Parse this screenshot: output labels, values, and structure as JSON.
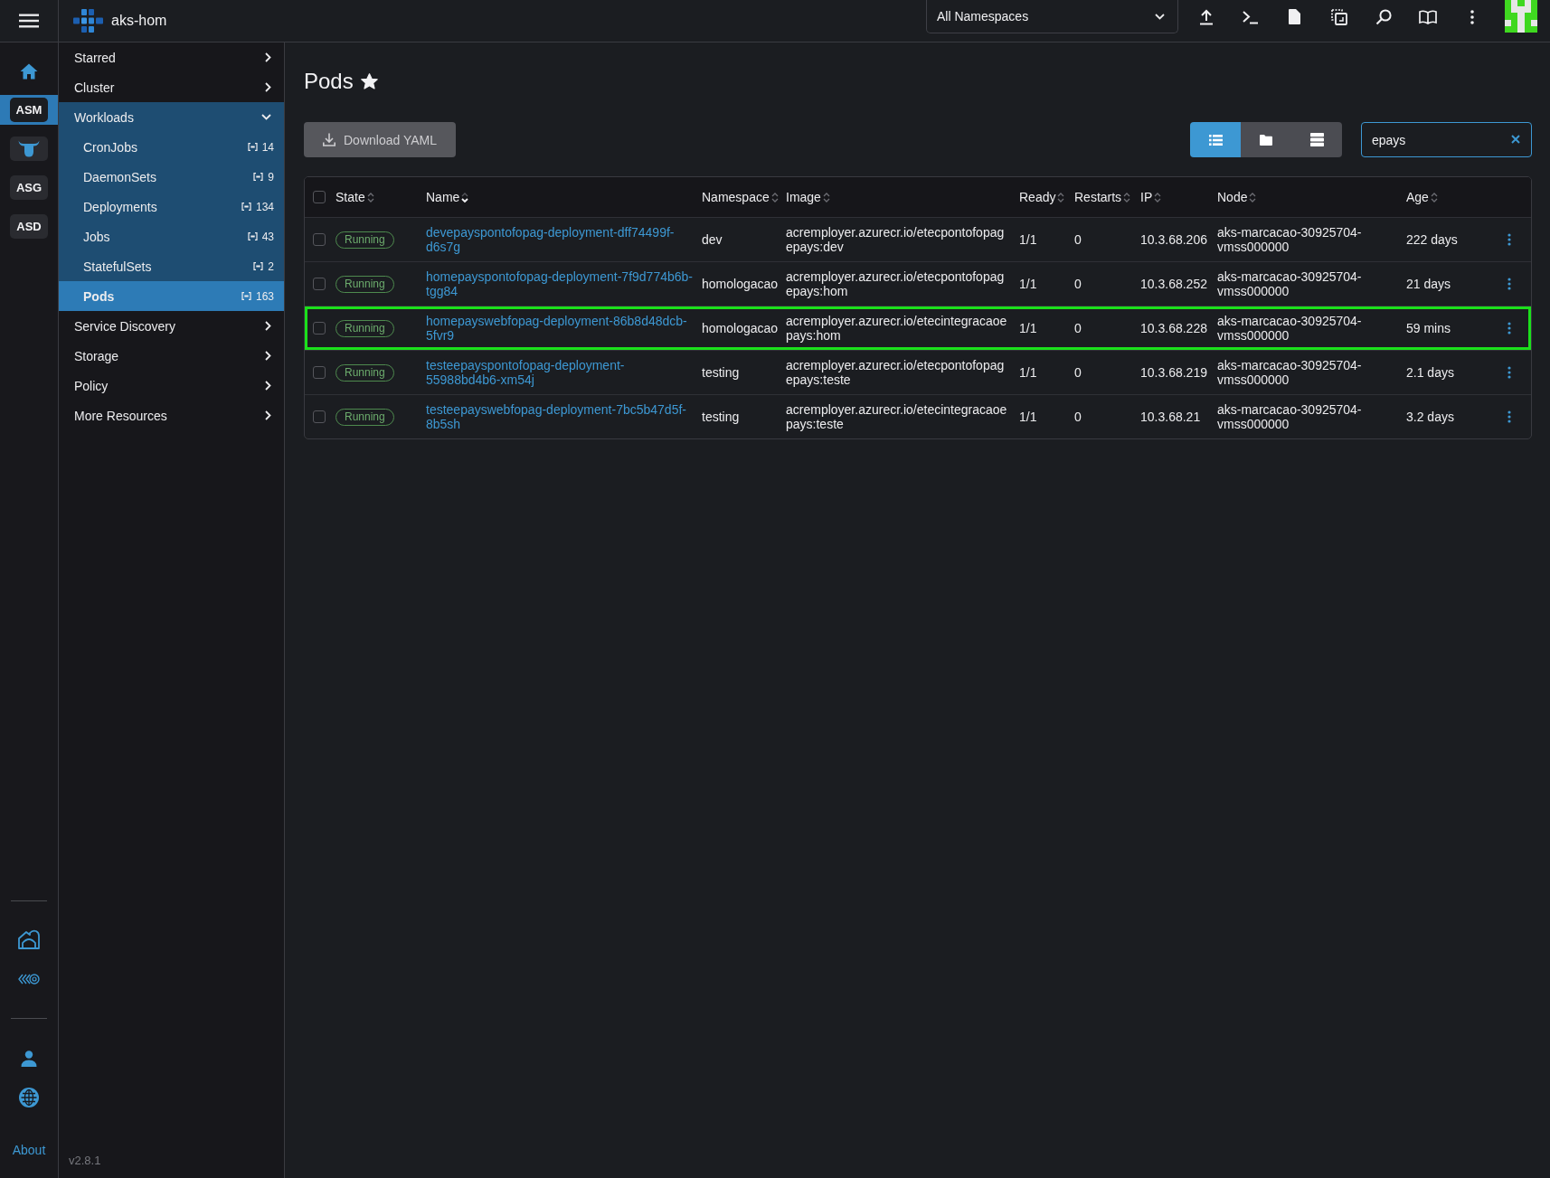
{
  "top_bar": {
    "cluster_name": "aks-hom",
    "namespace_filter": {
      "value": "All Namespaces"
    }
  },
  "rail": {
    "items": [
      {
        "kind": "home",
        "selected": false
      },
      {
        "kind": "label",
        "label": "ASM",
        "selected": true
      },
      {
        "kind": "bull",
        "selected": false
      },
      {
        "kind": "label",
        "label": "ASG",
        "selected": false
      },
      {
        "kind": "label",
        "label": "ASD",
        "selected": false
      }
    ],
    "about_link": "About"
  },
  "side_nav": {
    "items": [
      {
        "label": "Starred",
        "expanded": false
      },
      {
        "label": "Cluster",
        "expanded": false
      },
      {
        "label": "Workloads",
        "expanded": true,
        "children": [
          {
            "label": "CronJobs",
            "count": "14",
            "selected": false
          },
          {
            "label": "DaemonSets",
            "count": "9",
            "selected": false
          },
          {
            "label": "Deployments",
            "count": "134",
            "selected": false
          },
          {
            "label": "Jobs",
            "count": "43",
            "selected": false
          },
          {
            "label": "StatefulSets",
            "count": "2",
            "selected": false
          },
          {
            "label": "Pods",
            "count": "163",
            "selected": true
          }
        ]
      },
      {
        "label": "Service Discovery",
        "expanded": false
      },
      {
        "label": "Storage",
        "expanded": false
      },
      {
        "label": "Policy",
        "expanded": false
      },
      {
        "label": "More Resources",
        "expanded": false
      }
    ],
    "version": "v2.8.1"
  },
  "page": {
    "title": "Pods",
    "favorite": true,
    "download_button": "Download YAML",
    "view_modes": [
      {
        "kind": "flat",
        "selected": true
      },
      {
        "kind": "folder",
        "selected": false
      },
      {
        "kind": "group",
        "selected": false
      }
    ],
    "search": {
      "value": "epays"
    }
  },
  "table": {
    "all_checked": false,
    "columns": [
      {
        "label": "State",
        "sorted": false
      },
      {
        "label": "Name",
        "sorted": true
      },
      {
        "label": "Namespace",
        "sorted": false
      },
      {
        "label": "Image",
        "sorted": false
      },
      {
        "label": "Ready",
        "sorted": false
      },
      {
        "label": "Restarts",
        "sorted": false
      },
      {
        "label": "IP",
        "sorted": false
      },
      {
        "label": "Node",
        "sorted": false
      },
      {
        "label": "Age",
        "sorted": false
      }
    ],
    "rows": [
      {
        "checked": false,
        "highlighted": false,
        "state": "Running",
        "name": "devepayspontofopag-deployment-dff74499f-d6s7g",
        "namespace": "dev",
        "image": "acremployer.azurecr.io/etecpontofopagepays:dev",
        "ready": "1/1",
        "restarts": "0",
        "ip": "10.3.68.206",
        "node": "aks-marcacao-30925704-vmss000000",
        "age": "222 days"
      },
      {
        "checked": false,
        "highlighted": false,
        "state": "Running",
        "name": "homepayspontofopag-deployment-7f9d774b6b-tgg84",
        "namespace": "homologacao",
        "image": "acremployer.azurecr.io/etecpontofopagepays:hom",
        "ready": "1/1",
        "restarts": "0",
        "ip": "10.3.68.252",
        "node": "aks-marcacao-30925704-vmss000000",
        "age": "21 days"
      },
      {
        "checked": false,
        "highlighted": true,
        "state": "Running",
        "name": "homepayswebfopag-deployment-86b8d48dcb-5fvr9",
        "namespace": "homologacao",
        "image": "acremployer.azurecr.io/etecintegracaoepays:hom",
        "ready": "1/1",
        "restarts": "0",
        "ip": "10.3.68.228",
        "node": "aks-marcacao-30925704-vmss000000",
        "age": "59 mins"
      },
      {
        "checked": false,
        "highlighted": false,
        "state": "Running",
        "name": "testeepayspontofopag-deployment-55988bd4b6-xm54j",
        "namespace": "testing",
        "image": "acremployer.azurecr.io/etecpontofopagepays:teste",
        "ready": "1/1",
        "restarts": "0",
        "ip": "10.3.68.219",
        "node": "aks-marcacao-30925704-vmss000000",
        "age": "2.1 days"
      },
      {
        "checked": false,
        "highlighted": false,
        "state": "Running",
        "name": "testeepayswebfopag-deployment-7bc5b47d5f-8b5sh",
        "namespace": "testing",
        "image": "acremployer.azurecr.io/etecintegracaoepays:teste",
        "ready": "1/1",
        "restarts": "0",
        "ip": "10.3.68.21",
        "node": "aks-marcacao-30925704-vmss000000",
        "age": "3.2 days"
      }
    ]
  }
}
